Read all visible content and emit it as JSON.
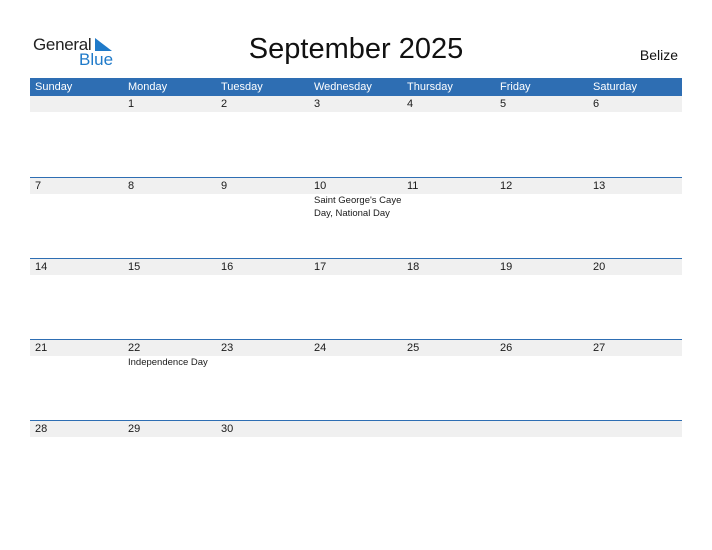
{
  "logo": {
    "line1": "General",
    "line2": "Blue"
  },
  "title": "September 2025",
  "country": "Belize",
  "colors": {
    "header_bg": "#2e6eb3",
    "accent": "#1f7ac9",
    "day_bar": "#f0f0f0"
  },
  "weekdays": [
    "Sunday",
    "Monday",
    "Tuesday",
    "Wednesday",
    "Thursday",
    "Friday",
    "Saturday"
  ],
  "weeks": [
    {
      "days": [
        {
          "num": "",
          "holiday": ""
        },
        {
          "num": "1",
          "holiday": ""
        },
        {
          "num": "2",
          "holiday": ""
        },
        {
          "num": "3",
          "holiday": ""
        },
        {
          "num": "4",
          "holiday": ""
        },
        {
          "num": "5",
          "holiday": ""
        },
        {
          "num": "6",
          "holiday": ""
        }
      ]
    },
    {
      "days": [
        {
          "num": "7",
          "holiday": ""
        },
        {
          "num": "8",
          "holiday": ""
        },
        {
          "num": "9",
          "holiday": ""
        },
        {
          "num": "10",
          "holiday": "Saint George's Caye Day, National Day"
        },
        {
          "num": "11",
          "holiday": ""
        },
        {
          "num": "12",
          "holiday": ""
        },
        {
          "num": "13",
          "holiday": ""
        }
      ]
    },
    {
      "days": [
        {
          "num": "14",
          "holiday": ""
        },
        {
          "num": "15",
          "holiday": ""
        },
        {
          "num": "16",
          "holiday": ""
        },
        {
          "num": "17",
          "holiday": ""
        },
        {
          "num": "18",
          "holiday": ""
        },
        {
          "num": "19",
          "holiday": ""
        },
        {
          "num": "20",
          "holiday": ""
        }
      ]
    },
    {
      "days": [
        {
          "num": "21",
          "holiday": ""
        },
        {
          "num": "22",
          "holiday": "Independence Day"
        },
        {
          "num": "23",
          "holiday": ""
        },
        {
          "num": "24",
          "holiday": ""
        },
        {
          "num": "25",
          "holiday": ""
        },
        {
          "num": "26",
          "holiday": ""
        },
        {
          "num": "27",
          "holiday": ""
        }
      ]
    },
    {
      "days": [
        {
          "num": "28",
          "holiday": ""
        },
        {
          "num": "29",
          "holiday": ""
        },
        {
          "num": "30",
          "holiday": ""
        },
        {
          "num": "",
          "holiday": ""
        },
        {
          "num": "",
          "holiday": ""
        },
        {
          "num": "",
          "holiday": ""
        },
        {
          "num": "",
          "holiday": ""
        }
      ]
    }
  ]
}
